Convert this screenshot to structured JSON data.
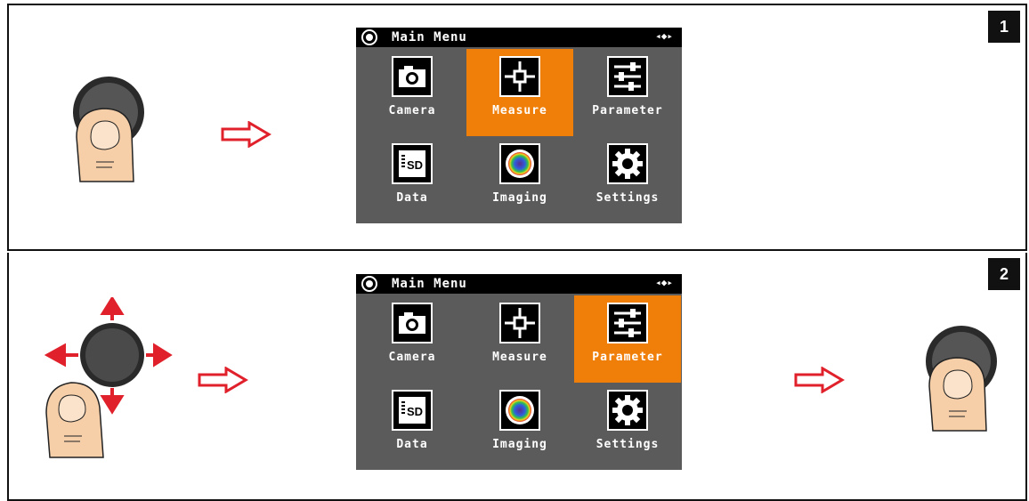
{
  "panels": [
    {
      "step": "1",
      "menu": {
        "title": "Main Menu",
        "nav_indicator": "◂◆▸",
        "items": [
          {
            "label": "Camera",
            "icon": "camera-icon",
            "selected": false
          },
          {
            "label": "Measure",
            "icon": "measure-crosshair-icon",
            "selected": true
          },
          {
            "label": "Parameter",
            "icon": "parameter-sliders-icon",
            "selected": false
          },
          {
            "label": "Data",
            "icon": "sd-card-icon",
            "selected": false
          },
          {
            "label": "Imaging",
            "icon": "color-wheel-icon",
            "selected": false
          },
          {
            "label": "Settings",
            "icon": "gear-icon",
            "selected": false
          }
        ]
      }
    },
    {
      "step": "2",
      "menu": {
        "title": "Main Menu",
        "nav_indicator": "◂◆▸",
        "items": [
          {
            "label": "Camera",
            "icon": "camera-icon",
            "selected": false
          },
          {
            "label": "Measure",
            "icon": "measure-crosshair-icon",
            "selected": false
          },
          {
            "label": "Parameter",
            "icon": "parameter-sliders-icon",
            "selected": true
          },
          {
            "label": "Data",
            "icon": "sd-card-icon",
            "selected": false
          },
          {
            "label": "Imaging",
            "icon": "color-wheel-icon",
            "selected": false
          },
          {
            "label": "Settings",
            "icon": "gear-icon",
            "selected": false
          }
        ]
      }
    }
  ],
  "colors": {
    "selected": "#f07f0a",
    "screen_bg": "#5b5b5b",
    "arrow": "#e0202a",
    "skin": "#f6cfa9"
  }
}
